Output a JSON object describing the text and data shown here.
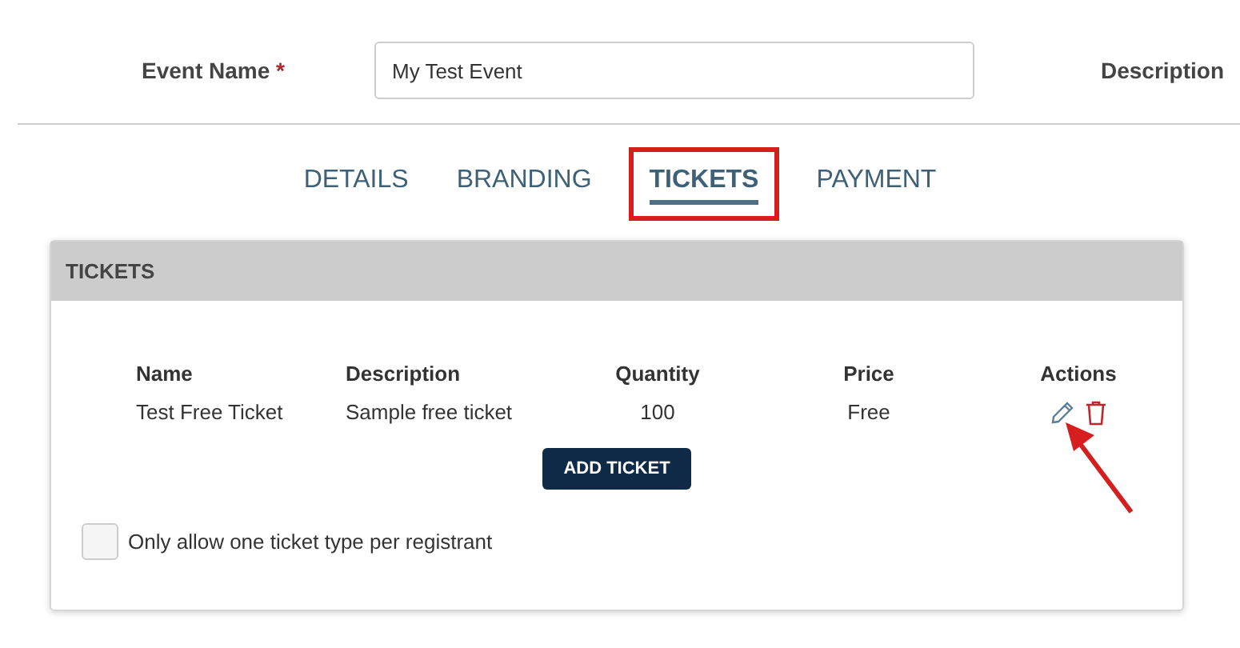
{
  "event_name": {
    "label": "Event Name",
    "required_mark": "*",
    "value": "My Test Event"
  },
  "description_label": "Description",
  "tabs": [
    {
      "label": "DETAILS",
      "selected": false
    },
    {
      "label": "BRANDING",
      "selected": false
    },
    {
      "label": "TICKETS",
      "selected": true
    },
    {
      "label": "PAYMENT",
      "selected": false
    }
  ],
  "tickets_panel": {
    "title": "TICKETS",
    "columns": [
      "Name",
      "Description",
      "Quantity",
      "Price",
      "Actions"
    ],
    "rows": [
      {
        "name": "Test Free Ticket",
        "description": "Sample free ticket",
        "quantity": "100",
        "price": "Free"
      }
    ],
    "add_button": "ADD TICKET",
    "one_type_option": {
      "label": "Only allow one ticket type per registrant",
      "checked": false
    }
  }
}
